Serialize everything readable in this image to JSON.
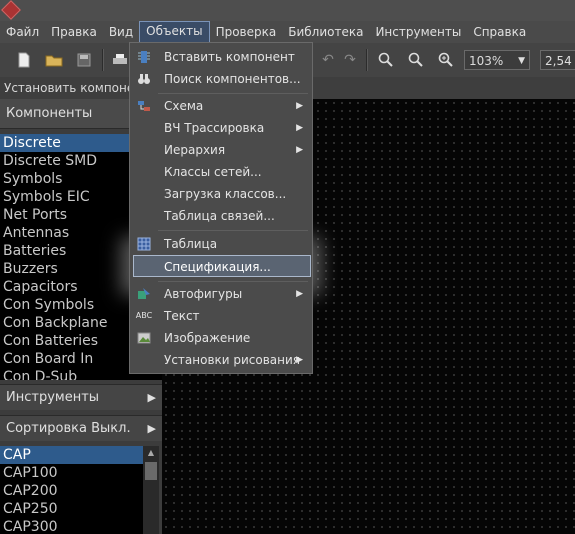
{
  "menubar": {
    "items": [
      {
        "label": "Файл"
      },
      {
        "label": "Правка"
      },
      {
        "label": "Вид"
      },
      {
        "label": "Объекты",
        "active": true
      },
      {
        "label": "Проверка"
      },
      {
        "label": "Библиотека"
      },
      {
        "label": "Инструменты"
      },
      {
        "label": "Справка"
      }
    ]
  },
  "toolbar": {
    "zoom_value": "103%",
    "grid_value": "2,54"
  },
  "hint_text": "Установить компонент",
  "components_panel": {
    "title": "Компоненты",
    "items": [
      "Discrete",
      "Discrete SMD",
      "Symbols",
      "Symbols EIC",
      "Net Ports",
      "Antennas",
      "Batteries",
      "Buzzers",
      "Capacitors",
      "Con Symbols",
      "Con Backplane",
      "Con Batteries",
      "Con Board In",
      "Con D-Sub"
    ],
    "selected": "Discrete"
  },
  "tools_panel": {
    "title": "Инструменты"
  },
  "sort_panel": {
    "title": "Сортировка Выкл."
  },
  "parts_list": {
    "items": [
      "CAP",
      "CAP100",
      "CAP200",
      "CAP250",
      "CAP300"
    ],
    "selected": "CAP"
  },
  "objects_menu": {
    "items": [
      {
        "label": "Вставить компонент",
        "icon": "chip-icon"
      },
      {
        "label": "Поиск компонентов...",
        "icon": "binoculars-icon"
      },
      {
        "label": "Схема",
        "icon": "schematic-icon",
        "submenu": true
      },
      {
        "label": "ВЧ Трассировка",
        "submenu": true
      },
      {
        "label": "Иерархия",
        "submenu": true
      },
      {
        "label": "Классы сетей..."
      },
      {
        "label": "Загрузка классов..."
      },
      {
        "label": "Таблица связей..."
      },
      {
        "label": "Таблица",
        "icon": "table-icon"
      },
      {
        "label": "Спецификация...",
        "highlighted": true
      },
      {
        "label": "Автофигуры",
        "icon": "autoshape-icon",
        "submenu": true
      },
      {
        "label": "Текст",
        "icon": "text-icon",
        "icon_text": "ABC"
      },
      {
        "label": "Изображение",
        "icon": "image-icon"
      },
      {
        "label": "Установки рисования",
        "submenu": true
      }
    ]
  }
}
